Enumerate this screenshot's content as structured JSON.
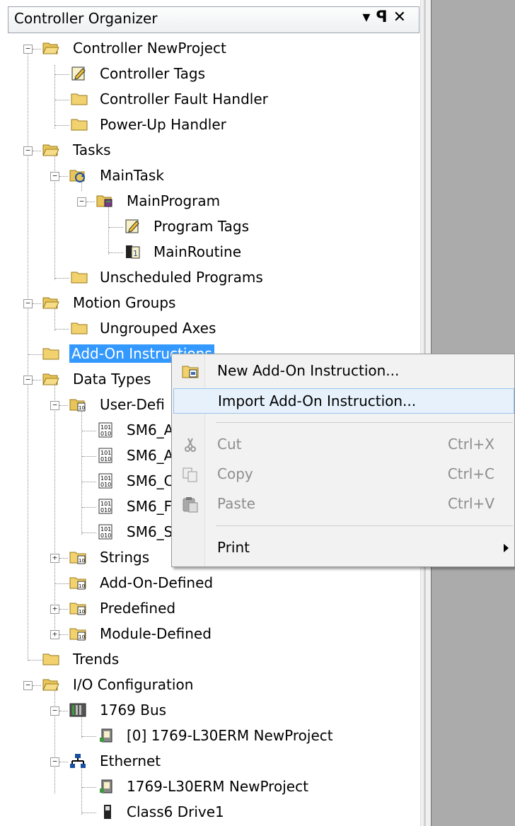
{
  "panel": {
    "title": "Controller Organizer",
    "buttons": [
      "▾",
      "ꟼ",
      "✕"
    ]
  },
  "tree": [
    {
      "label": "Controller NewProject",
      "icon": "folder-open-icon"
    },
    {
      "label": "Controller Tags",
      "icon": "tags-icon"
    },
    {
      "label": "Controller Fault Handler",
      "icon": "folder-icon"
    },
    {
      "label": "Power-Up Handler",
      "icon": "folder-icon"
    },
    {
      "label": "Tasks",
      "icon": "folder-open-icon"
    },
    {
      "label": "MainTask",
      "icon": "task-icon"
    },
    {
      "label": "MainProgram",
      "icon": "program-icon"
    },
    {
      "label": "Program Tags",
      "icon": "tags-icon"
    },
    {
      "label": "MainRoutine",
      "icon": "routine-icon"
    },
    {
      "label": "Unscheduled Programs",
      "icon": "folder-icon"
    },
    {
      "label": "Motion Groups",
      "icon": "folder-open-icon"
    },
    {
      "label": "Ungrouped Axes",
      "icon": "folder-icon"
    },
    {
      "label": "Add-On Instructions",
      "icon": "folder-icon"
    },
    {
      "label": "Data Types",
      "icon": "folder-open-icon"
    },
    {
      "label": "User-Defi",
      "icon": "datatype-folder-icon"
    },
    {
      "label": "SM6_A",
      "icon": "datatype-icon"
    },
    {
      "label": "SM6_A",
      "icon": "datatype-icon"
    },
    {
      "label": "SM6_C",
      "icon": "datatype-icon"
    },
    {
      "label": "SM6_F",
      "icon": "datatype-icon"
    },
    {
      "label": "SM6_S",
      "icon": "datatype-icon"
    },
    {
      "label": "Strings",
      "icon": "datatype-folder-icon"
    },
    {
      "label": "Add-On-Defined",
      "icon": "datatype-folder-icon"
    },
    {
      "label": "Predefined",
      "icon": "datatype-folder-icon"
    },
    {
      "label": "Module-Defined",
      "icon": "datatype-folder-icon"
    },
    {
      "label": "Trends",
      "icon": "folder-icon"
    },
    {
      "label": "I/O Configuration",
      "icon": "folder-open-icon"
    },
    {
      "label": "1769 Bus",
      "icon": "bus-icon"
    },
    {
      "label": "[0] 1769-L30ERM NewProject",
      "icon": "module-icon"
    },
    {
      "label": "Ethernet",
      "icon": "network-icon"
    },
    {
      "label": "1769-L30ERM NewProject",
      "icon": "module-icon"
    },
    {
      "label": "Class6 Drive1",
      "icon": "drive-icon"
    }
  ],
  "context_menu": {
    "items": [
      {
        "label": "New Add-On Instruction...",
        "shortcut": "",
        "icon": "new-aoi-icon",
        "enabled": true
      },
      {
        "label": "Import Add-On Instruction...",
        "shortcut": "",
        "icon": "",
        "enabled": true
      },
      {
        "label": "Cut",
        "shortcut": "Ctrl+X",
        "icon": "scissors-icon",
        "enabled": false
      },
      {
        "label": "Copy",
        "shortcut": "Ctrl+C",
        "icon": "copy-icon",
        "enabled": false
      },
      {
        "label": "Paste",
        "shortcut": "Ctrl+V",
        "icon": "paste-icon",
        "enabled": false
      },
      {
        "label": "Print",
        "shortcut": "",
        "icon": "",
        "enabled": true
      }
    ]
  },
  "colors": {
    "selection": "#3399ff",
    "menu_highlight": "#e6f1fb",
    "workspace": "#ababab"
  }
}
